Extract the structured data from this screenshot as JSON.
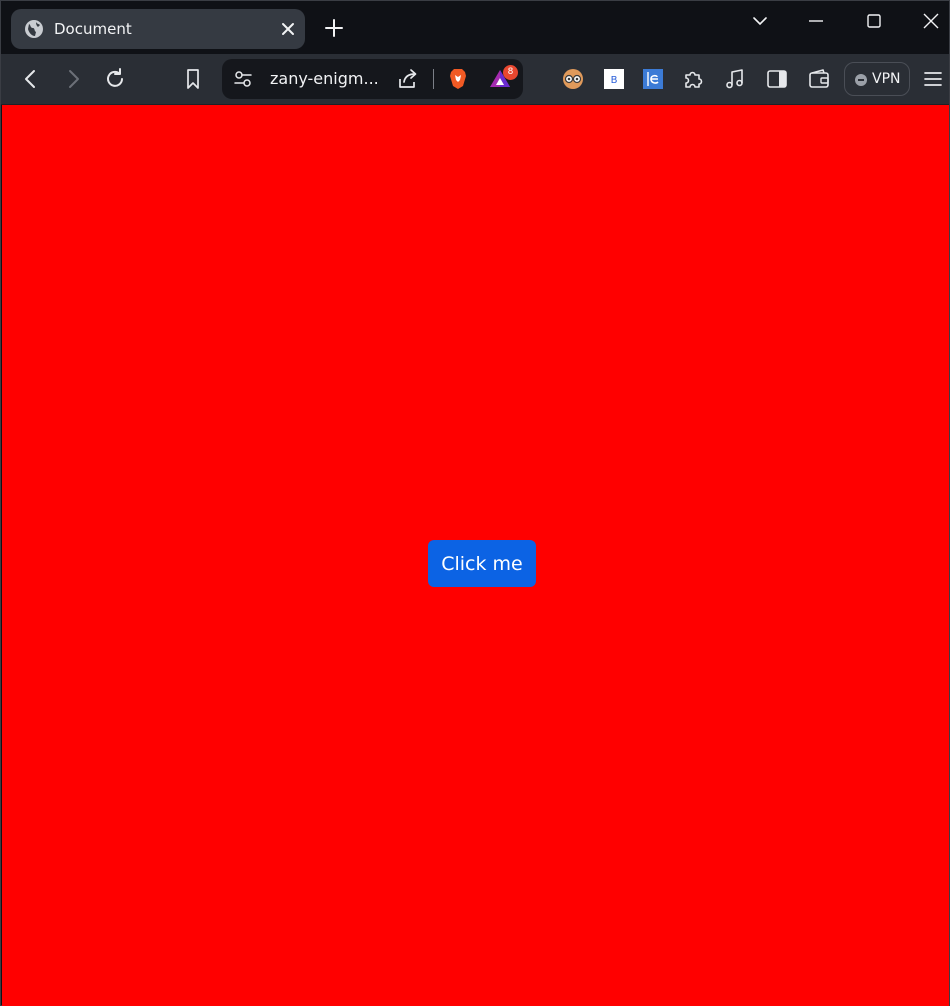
{
  "browser": {
    "tab": {
      "title": "Document",
      "favicon": "globe-icon"
    },
    "toolbar": {
      "url": "zany-enigm...",
      "shields_badge": "8",
      "vpn_label": "VPN"
    },
    "colors": {
      "chrome_dark": "#0f1116",
      "toolbar": "#2a2e35",
      "tab_active": "#353a42",
      "omnibox": "#15171c",
      "badge": "#e8472f"
    }
  },
  "page": {
    "background": "#ff0000",
    "button": {
      "label": "Click me",
      "color": "#0c63e4",
      "text_color": "#ffffff"
    }
  }
}
